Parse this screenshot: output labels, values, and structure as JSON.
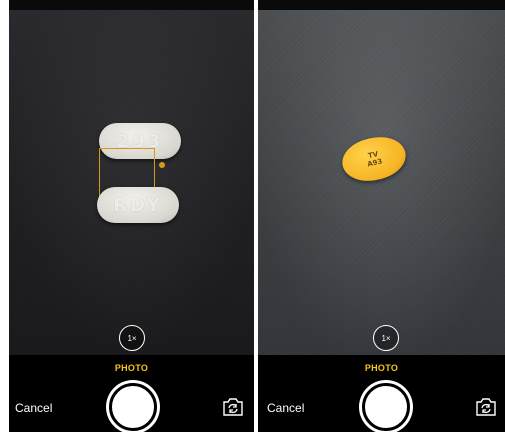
{
  "screens": [
    {
      "pills": [
        {
          "imprint": "293",
          "color": "white"
        },
        {
          "imprint": "RDY",
          "color": "white"
        }
      ],
      "zoom_label": "1×",
      "mode_label": "PHOTO",
      "cancel_label": "Cancel",
      "flip_icon": "switch-camera-icon"
    },
    {
      "pills": [
        {
          "imprint_line1": "TV",
          "imprint_line2": "A93",
          "color": "yellow"
        }
      ],
      "zoom_label": "1×",
      "mode_label": "PHOTO",
      "cancel_label": "Cancel",
      "flip_icon": "switch-camera-icon"
    }
  ],
  "colors": {
    "accent_yellow": "#f5c518",
    "focus_box": "#d39a1e",
    "shutter": "#ffffff"
  }
}
